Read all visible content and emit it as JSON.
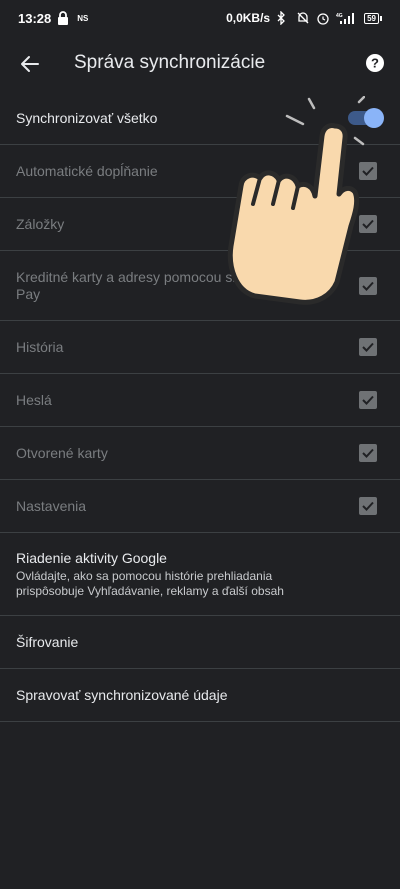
{
  "status_bar": {
    "time": "13:28",
    "ns": "NS",
    "net_speed": "0,0KB/s",
    "battery": "59"
  },
  "toolbar": {
    "title": "Správa synchronizácie"
  },
  "sync_all": {
    "label": "Synchronizovať všetko",
    "enabled": true
  },
  "items": [
    {
      "label": "Automatické dopĺňanie",
      "checked": true
    },
    {
      "label": "Záložky",
      "checked": true
    },
    {
      "label": "Kreditné karty a adresy pomocou služby Google Pay",
      "checked": true
    },
    {
      "label": "História",
      "checked": true
    },
    {
      "label": "Heslá",
      "checked": true
    },
    {
      "label": "Otvorené karty",
      "checked": true
    },
    {
      "label": "Nastavenia",
      "checked": true
    }
  ],
  "activity": {
    "title": "Riadenie aktivity Google",
    "subtitle": "Ovládajte, ako sa pomocou histórie prehliadania prispôsobuje Vyhľadávanie, reklamy a ďalší obsah"
  },
  "encryption": {
    "label": "Šifrovanie"
  },
  "manage": {
    "label": "Spravovať synchronizované údaje"
  },
  "colors": {
    "background": "#202124",
    "accent": "#8ab4f8",
    "divider": "#3c4043",
    "disabled_text": "#7a7d80"
  }
}
